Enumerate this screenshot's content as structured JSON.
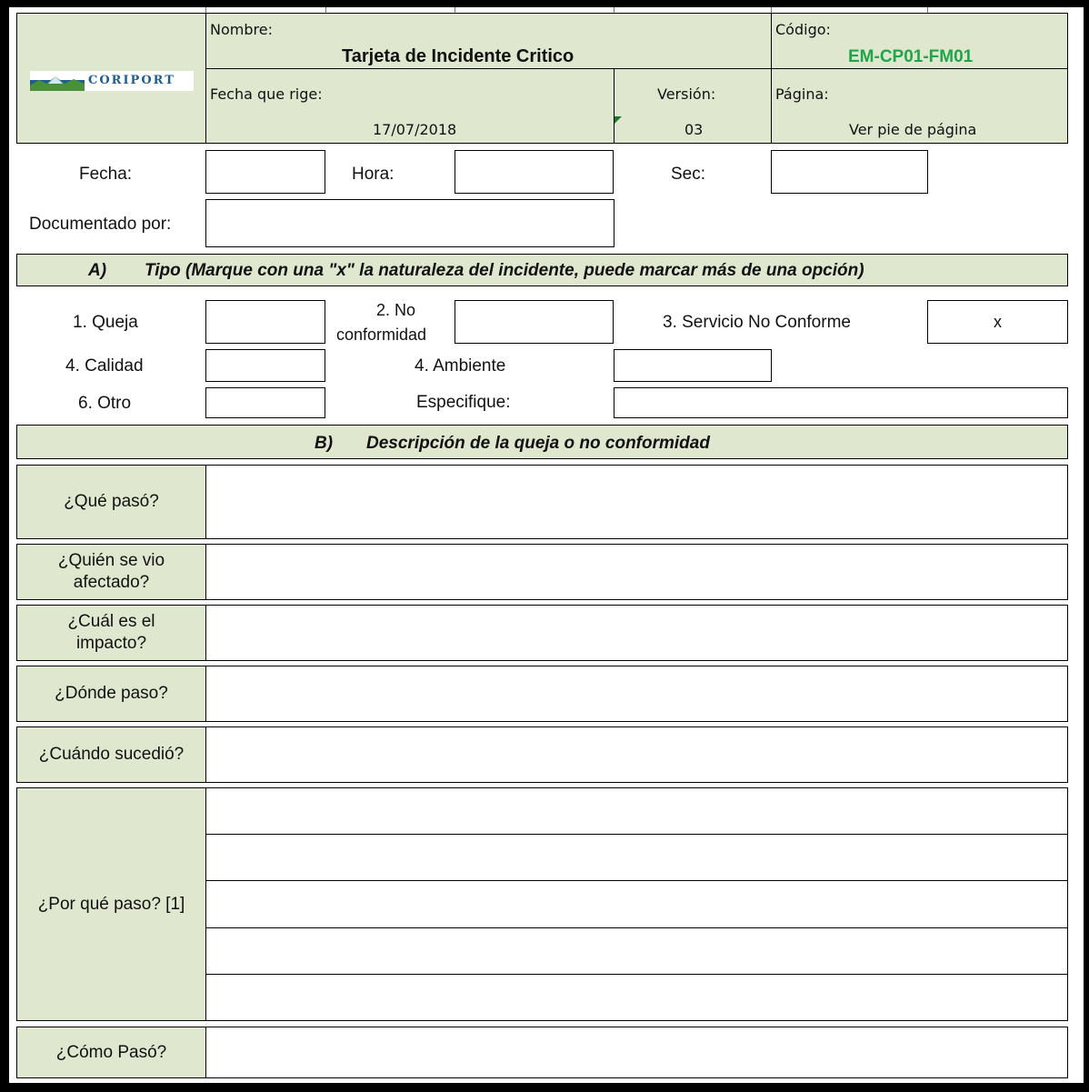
{
  "header": {
    "logo_text": "CORIPORT",
    "nombre_label": "Nombre:",
    "title": "Tarjeta de Incidente Critico",
    "codigo_label": "Código:",
    "codigo_value": "EM-CP01-FM01",
    "fecha_rige_label": "Fecha que rige:",
    "fecha_rige_value": "17/07/2018",
    "version_label": "Versión:",
    "version_value": "03",
    "pagina_label": "Página:",
    "pagina_value": "Ver pie de página"
  },
  "form": {
    "fecha_label": "Fecha:",
    "fecha_value": "",
    "hora_label": "Hora:",
    "hora_value": "",
    "sec_label": "Sec:",
    "sec_value": "",
    "documentado_label": "Documentado por:",
    "documentado_value": ""
  },
  "section_a": {
    "letter": "A)",
    "title": "Tipo (Marque con una \"x\" la naturaleza del incidente, puede marcar más de una opción)",
    "queja_label": "1. Queja",
    "queja_value": "",
    "no_conf_label_line1": "2. No",
    "no_conf_label_line2": "conformidad",
    "no_conf_value": "",
    "servicio_label": "3. Servicio No Conforme",
    "servicio_value": "x",
    "calidad_label": "4. Calidad",
    "calidad_value": "",
    "ambiente_label": "4. Ambiente",
    "ambiente_value": "",
    "otro_label": "6. Otro",
    "otro_value": "",
    "especifique_label": "Especifique:",
    "especifique_value": ""
  },
  "section_b": {
    "letter": "B)",
    "title": "Descripción de la queja o no conformidad",
    "que_paso": "¿Qué pasó?",
    "quien_line1": "¿Quién se vio",
    "quien_line2": "afectado?",
    "cual_line1": "¿Cuál es el",
    "cual_line2": "impacto?",
    "donde": "¿Dónde paso?",
    "cuando": "¿Cuándo sucedió?",
    "por_que": "¿Por qué paso? [1]",
    "como": "¿Cómo Pasó?"
  },
  "colors": {
    "header_green": "#dfe8cf",
    "code_green": "#1fa64a",
    "border": "#000000"
  }
}
